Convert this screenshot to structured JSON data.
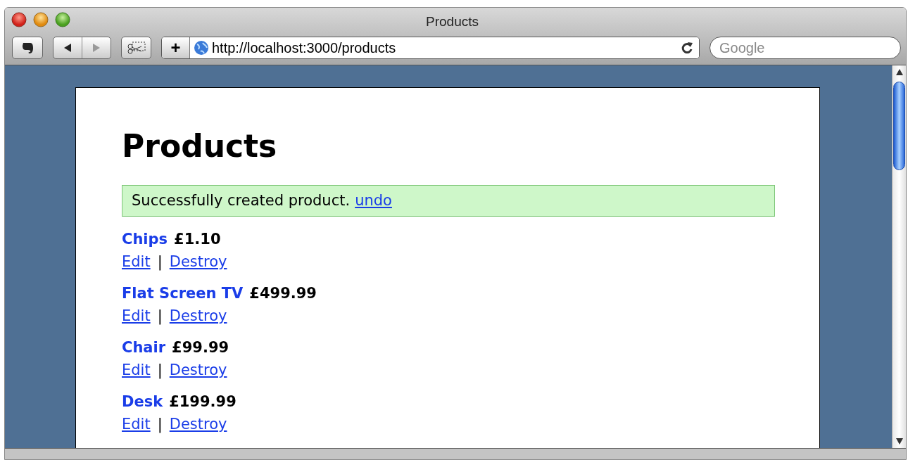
{
  "window": {
    "title": "Products"
  },
  "toolbar": {
    "back_enabled": true,
    "forward_enabled": false,
    "add_button": "+",
    "address": "http://localhost:3000/products",
    "search": {
      "placeholder": "Google"
    }
  },
  "page": {
    "heading": "Products",
    "notice": {
      "text": "Successfully created product.",
      "link": "undo"
    },
    "products": [
      {
        "name": "Chips",
        "price": "£1.10",
        "edit": "Edit",
        "separator": "|",
        "destroy": "Destroy"
      },
      {
        "name": "Flat Screen TV",
        "price": "£499.99",
        "edit": "Edit",
        "separator": "|",
        "destroy": "Destroy"
      },
      {
        "name": "Chair",
        "price": "£99.99",
        "edit": "Edit",
        "separator": "|",
        "destroy": "Destroy"
      },
      {
        "name": "Desk",
        "price": "£199.99",
        "edit": "Edit",
        "separator": "|",
        "destroy": "Destroy"
      }
    ]
  }
}
